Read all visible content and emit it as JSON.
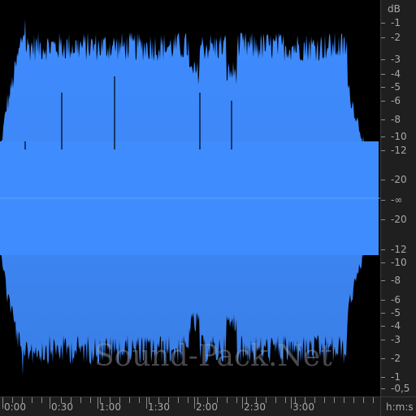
{
  "editor": {
    "waveform_color_top": "#3f8cff",
    "waveform_color_bottom": "#3a7fe6",
    "background": "#000000"
  },
  "db_ruler": {
    "unit": "dB",
    "labels_top": [
      "-1",
      "-2",
      "-3",
      "-4",
      "-5",
      "-6",
      "-8",
      "-10",
      "-12",
      "-20"
    ],
    "center": "-∞",
    "labels_bottom": [
      "-20",
      "-12",
      "-10",
      "-8",
      "-6",
      "-5",
      "-4",
      "-3",
      "-2",
      "-1",
      "-0,5"
    ]
  },
  "time_ruler": {
    "labels": [
      "0:00",
      "0:30",
      "1:00",
      "1:30",
      "2:00",
      "2:30",
      "3:00"
    ],
    "unit": "h:m:s"
  },
  "watermark": "Sound-Pack.Net"
}
